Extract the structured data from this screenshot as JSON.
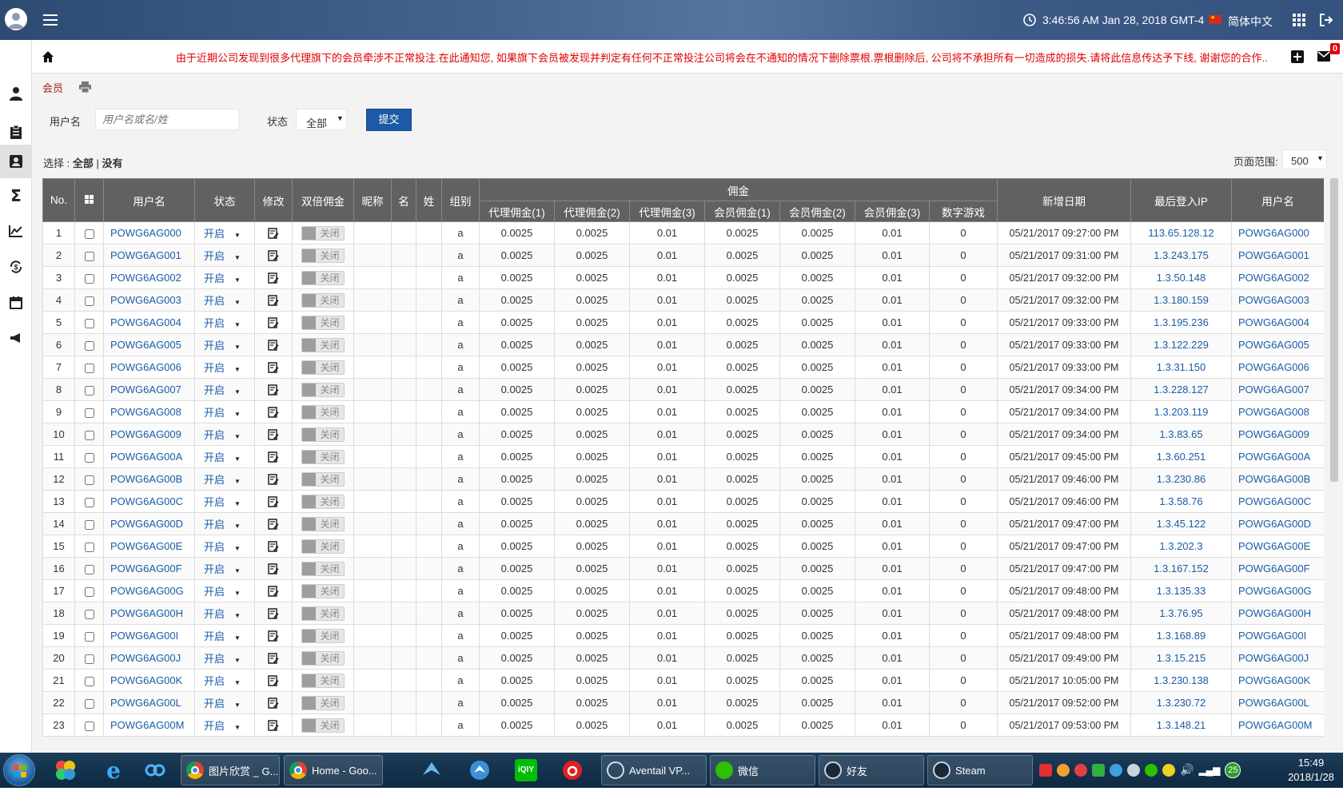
{
  "topbar": {
    "datetime": "3:46:56 AM Jan 28, 2018 GMT-4",
    "language": "简体中文"
  },
  "ticker": {
    "notice": "由于近期公司发现到很多代理旗下的会员牵涉不正常投注.在此通知您, 如果旗下会员被发现并判定有任何不正常投注公司将会在不通知的情况下删除票根.票根删除后, 公司将不承担所有一切造成的损失.请将此信息传达予下线, 谢谢您的合作..",
    "mail_count": "0"
  },
  "page": {
    "title": "会员",
    "filter": {
      "username_label": "用户名",
      "username_placeholder": "用户名或名/姓",
      "status_label": "状态",
      "status_value": "全部",
      "submit_label": "提交"
    },
    "select": {
      "label": "选择 :",
      "all": "全部",
      "separator": "|",
      "none": "没有"
    },
    "page_size_label": "页面范围:",
    "page_size_value": "500"
  },
  "table": {
    "headers": {
      "no": "No.",
      "username": "用户名",
      "status": "状态",
      "edit": "修改",
      "double_commission": "双倍佣金",
      "nickname": "昵称",
      "first_name": "名",
      "last_name": "姓",
      "group": "组别",
      "commission_group": "佣金",
      "agent_c1": "代理佣金(1)",
      "agent_c2": "代理佣金(2)",
      "agent_c3": "代理佣金(3)",
      "member_c1": "会员佣金(1)",
      "member_c2": "会员佣金(2)",
      "member_c3": "会员佣金(3)",
      "digital_games": "数字游戏",
      "created_date": "新增日期",
      "last_ip": "最后登入IP",
      "username2": "用户名"
    },
    "status_text": "开启",
    "toggle_text": "关闭",
    "group_value": "a",
    "commission_values": [
      "0.0025",
      "0.0025",
      "0.01",
      "0.0025",
      "0.0025",
      "0.01",
      "0"
    ],
    "rows": [
      {
        "no": "1",
        "user": "POWG6AG000",
        "date": "05/21/2017 09:27:00 PM",
        "ip": "113.65.128.12"
      },
      {
        "no": "2",
        "user": "POWG6AG001",
        "date": "05/21/2017 09:31:00 PM",
        "ip": "1.3.243.175"
      },
      {
        "no": "3",
        "user": "POWG6AG002",
        "date": "05/21/2017 09:32:00 PM",
        "ip": "1.3.50.148"
      },
      {
        "no": "4",
        "user": "POWG6AG003",
        "date": "05/21/2017 09:32:00 PM",
        "ip": "1.3.180.159"
      },
      {
        "no": "5",
        "user": "POWG6AG004",
        "date": "05/21/2017 09:33:00 PM",
        "ip": "1.3.195.236"
      },
      {
        "no": "6",
        "user": "POWG6AG005",
        "date": "05/21/2017 09:33:00 PM",
        "ip": "1.3.122.229"
      },
      {
        "no": "7",
        "user": "POWG6AG006",
        "date": "05/21/2017 09:33:00 PM",
        "ip": "1.3.31.150"
      },
      {
        "no": "8",
        "user": "POWG6AG007",
        "date": "05/21/2017 09:34:00 PM",
        "ip": "1.3.228.127"
      },
      {
        "no": "9",
        "user": "POWG6AG008",
        "date": "05/21/2017 09:34:00 PM",
        "ip": "1.3.203.119"
      },
      {
        "no": "10",
        "user": "POWG6AG009",
        "date": "05/21/2017 09:34:00 PM",
        "ip": "1.3.83.65"
      },
      {
        "no": "11",
        "user": "POWG6AG00A",
        "date": "05/21/2017 09:45:00 PM",
        "ip": "1.3.60.251"
      },
      {
        "no": "12",
        "user": "POWG6AG00B",
        "date": "05/21/2017 09:46:00 PM",
        "ip": "1.3.230.86"
      },
      {
        "no": "13",
        "user": "POWG6AG00C",
        "date": "05/21/2017 09:46:00 PM",
        "ip": "1.3.58.76"
      },
      {
        "no": "14",
        "user": "POWG6AG00D",
        "date": "05/21/2017 09:47:00 PM",
        "ip": "1.3.45.122"
      },
      {
        "no": "15",
        "user": "POWG6AG00E",
        "date": "05/21/2017 09:47:00 PM",
        "ip": "1.3.202.3"
      },
      {
        "no": "16",
        "user": "POWG6AG00F",
        "date": "05/21/2017 09:47:00 PM",
        "ip": "1.3.167.152"
      },
      {
        "no": "17",
        "user": "POWG6AG00G",
        "date": "05/21/2017 09:48:00 PM",
        "ip": "1.3.135.33"
      },
      {
        "no": "18",
        "user": "POWG6AG00H",
        "date": "05/21/2017 09:48:00 PM",
        "ip": "1.3.76.95"
      },
      {
        "no": "19",
        "user": "POWG6AG00I",
        "date": "05/21/2017 09:48:00 PM",
        "ip": "1.3.168.89"
      },
      {
        "no": "20",
        "user": "POWG6AG00J",
        "date": "05/21/2017 09:49:00 PM",
        "ip": "1.3.15.215"
      },
      {
        "no": "21",
        "user": "POWG6AG00K",
        "date": "05/21/2017 10:05:00 PM",
        "ip": "1.3.230.138"
      },
      {
        "no": "22",
        "user": "POWG6AG00L",
        "date": "05/21/2017 09:52:00 PM",
        "ip": "1.3.230.72"
      },
      {
        "no": "23",
        "user": "POWG6AG00M",
        "date": "05/21/2017 09:53:00 PM",
        "ip": "1.3.148.21"
      }
    ]
  },
  "taskbar": {
    "windows": [
      {
        "label": "图片欣赏 _ G..."
      },
      {
        "label": "Home - Goo..."
      },
      {
        "label": "Aventail VP..."
      },
      {
        "label": "微信"
      },
      {
        "label": "好友"
      },
      {
        "label": "Steam"
      }
    ],
    "tray_badge": "25",
    "time": "15:49",
    "date": "2018/1/28"
  },
  "colors": {
    "accent_blue": "#1d5aa5",
    "header_gray": "#616161",
    "notice_red": "#e00000",
    "link_blue": "#1a5da8"
  }
}
